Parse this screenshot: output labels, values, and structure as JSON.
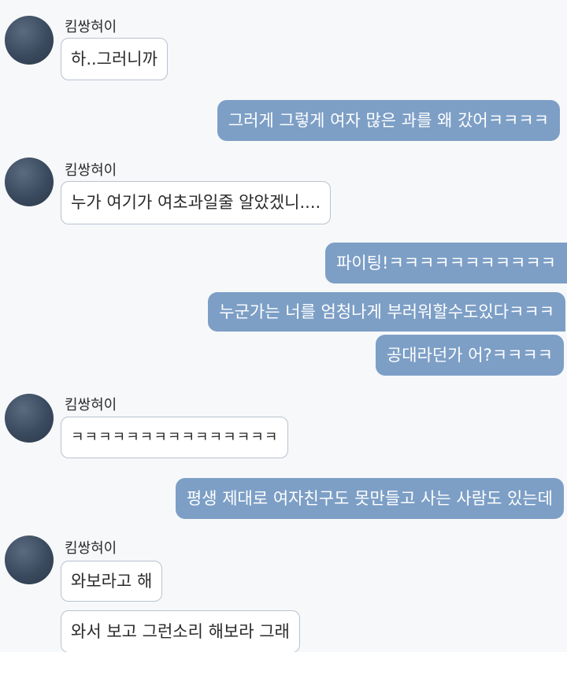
{
  "chat": {
    "sender_name": "킴쌍혀이",
    "messages": [
      {
        "side": "in",
        "text": "하..그러니까"
      },
      {
        "side": "out",
        "text": "그러게 그렇게 여자 많은 과를 왜 갔어ㅋㅋㅋㅋ"
      },
      {
        "side": "in",
        "text": "누가 여기가 여초과일줄 알았겠니...."
      },
      {
        "side": "out",
        "text": "파이팅!ㅋㅋㅋㅋㅋㅋㅋㅋㅋㅋㅋ"
      },
      {
        "side": "out",
        "text": "누군가는 너를 엄청나게 부러워할수도있다ㅋㅋㅋ"
      },
      {
        "side": "out",
        "text": "공대라던가 어?ㅋㅋㅋㅋ"
      },
      {
        "side": "in",
        "text": "ㅋㅋㅋㅋㅋㅋㅋㅋㅋㅋㅋㅋㅋㅋㅋ"
      },
      {
        "side": "out",
        "text": "평생 제대로 여자친구도 못만들고 사는 사람도 있는데"
      },
      {
        "side": "in",
        "text": "와보라고 해"
      },
      {
        "side": "in",
        "text": "와서 보고 그런소리 해보라 그래"
      }
    ]
  },
  "colors": {
    "outgoing_bubble": "#7d9fc6",
    "incoming_bubble": "#ffffff",
    "incoming_border": "#b8c3cf",
    "background": "#f7f8fa"
  }
}
